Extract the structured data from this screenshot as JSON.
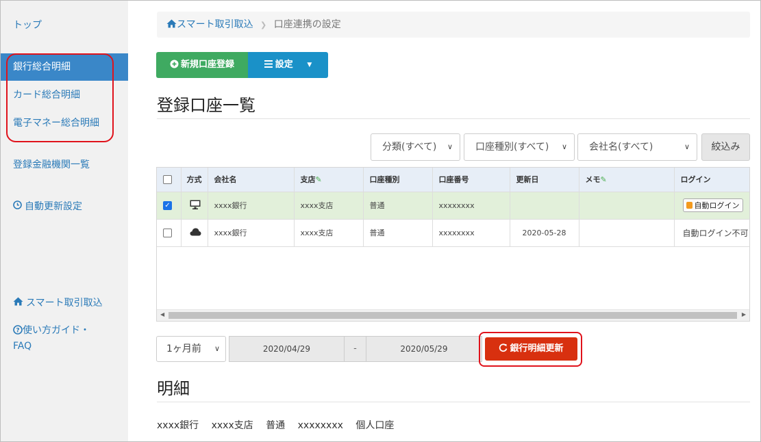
{
  "sidebar": {
    "top": "トップ",
    "bank": "銀行総合明細",
    "card": "カード総合明細",
    "emoney": "電子マネー総合明細",
    "institutions": "登録金融機関一覧",
    "auto_update": "自動更新設定",
    "smart": "スマート取引取込",
    "guide_line1": "使い方ガイド・",
    "guide_line2": "FAQ"
  },
  "breadcrumb": {
    "home": "スマート取引取込",
    "current": "口座連携の設定"
  },
  "toolbar": {
    "new_account": "新規口座登録",
    "settings": "設定"
  },
  "accounts_title": "登録口座一覧",
  "filters": {
    "category": "分類(すべて)",
    "account_type": "口座種別(すべて)",
    "company": "会社名(すべて)",
    "apply": "絞込み"
  },
  "table": {
    "headers": [
      "方式",
      "会社名",
      "支店",
      "口座種別",
      "口座番号",
      "更新日",
      "メモ",
      "ログイン"
    ],
    "rows": [
      {
        "company": "xxxx銀行",
        "branch": "xxxx支店",
        "type": "普通",
        "number": "xxxxxxxx",
        "updated": "",
        "memo": "",
        "login": "自動ログイン"
      },
      {
        "company": "xxxx銀行",
        "branch": "xxxx支店",
        "type": "普通",
        "number": "xxxxxxxx",
        "updated": "2020-05-28",
        "memo": "",
        "login": "自動ログイン不可"
      }
    ]
  },
  "range": {
    "period": "1ヶ月前",
    "from": "2020/04/29",
    "separator": "-",
    "to": "2020/05/29",
    "update": "銀行明細更新"
  },
  "details_title": "明細",
  "details_line": "xxxx銀行 xxxx支店 普通 xxxxxxxx 個人口座",
  "colors": {
    "accent_blue": "#3a87c8",
    "green": "#3faa61",
    "red": "#d8300f",
    "highlight": "#e0121b"
  }
}
